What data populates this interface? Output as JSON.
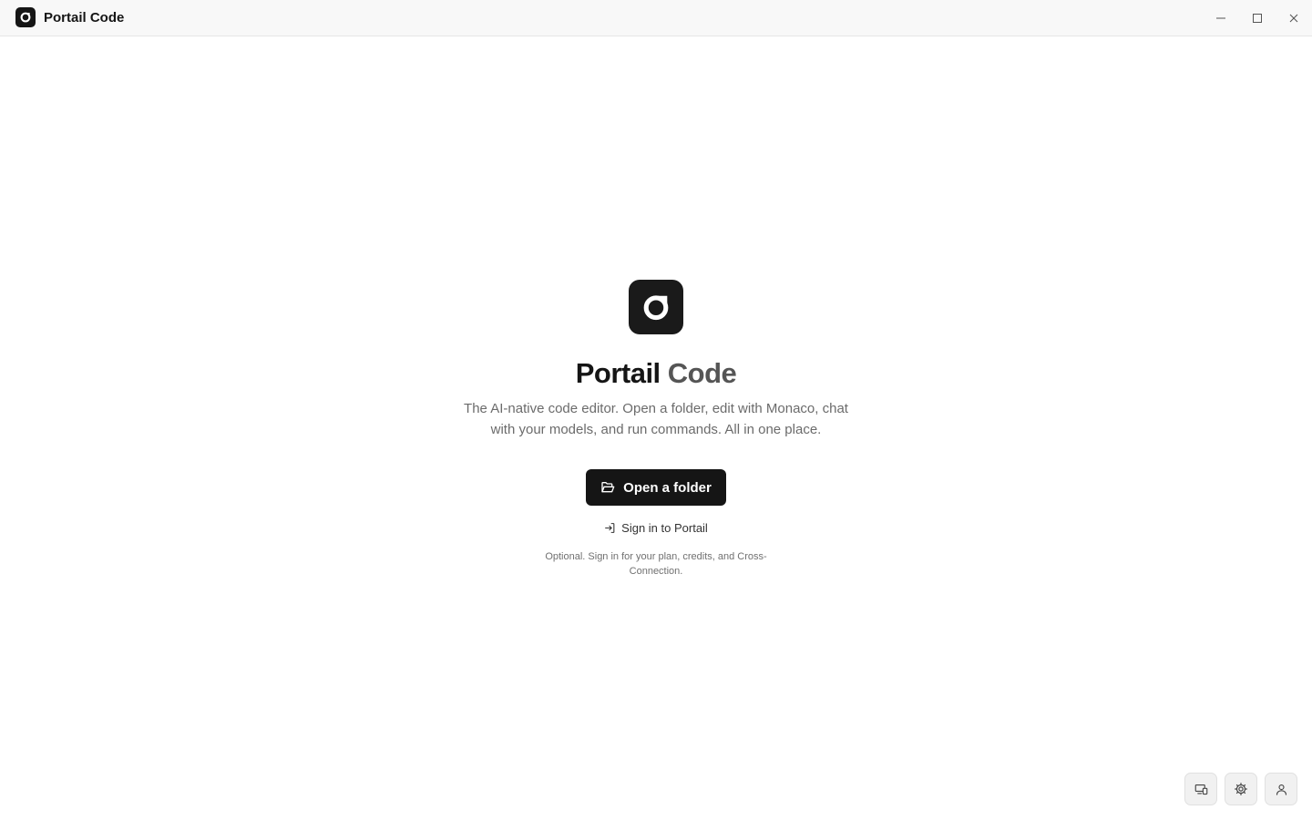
{
  "window": {
    "title": "Portail Code",
    "controls": {
      "minimize": "minimize-icon",
      "maximize": "maximize-icon",
      "close": "close-icon"
    }
  },
  "hero": {
    "logo_icon": "portail-logo-icon",
    "title_part1": "Portail",
    "title_part2": "Code",
    "subtitle": "The AI-native code editor. Open a folder, edit with Monaco, chat with your models, and run commands. All in one place.",
    "open_button_label": "Open a folder",
    "open_button_icon": "folder-open-icon",
    "signin_label": "Sign in to Portail",
    "signin_icon": "sign-in-icon",
    "hint": "Optional. Sign in for your plan, credits, and Cross-Connection."
  },
  "corner_buttons": [
    {
      "icon": "devices-icon"
    },
    {
      "icon": "gear-icon"
    },
    {
      "icon": "user-icon"
    }
  ],
  "colors": {
    "primary": "#151515",
    "title_secondary": "#555555",
    "muted_text": "#6b6b6b",
    "titlebar_bg": "#f8f8f8"
  }
}
